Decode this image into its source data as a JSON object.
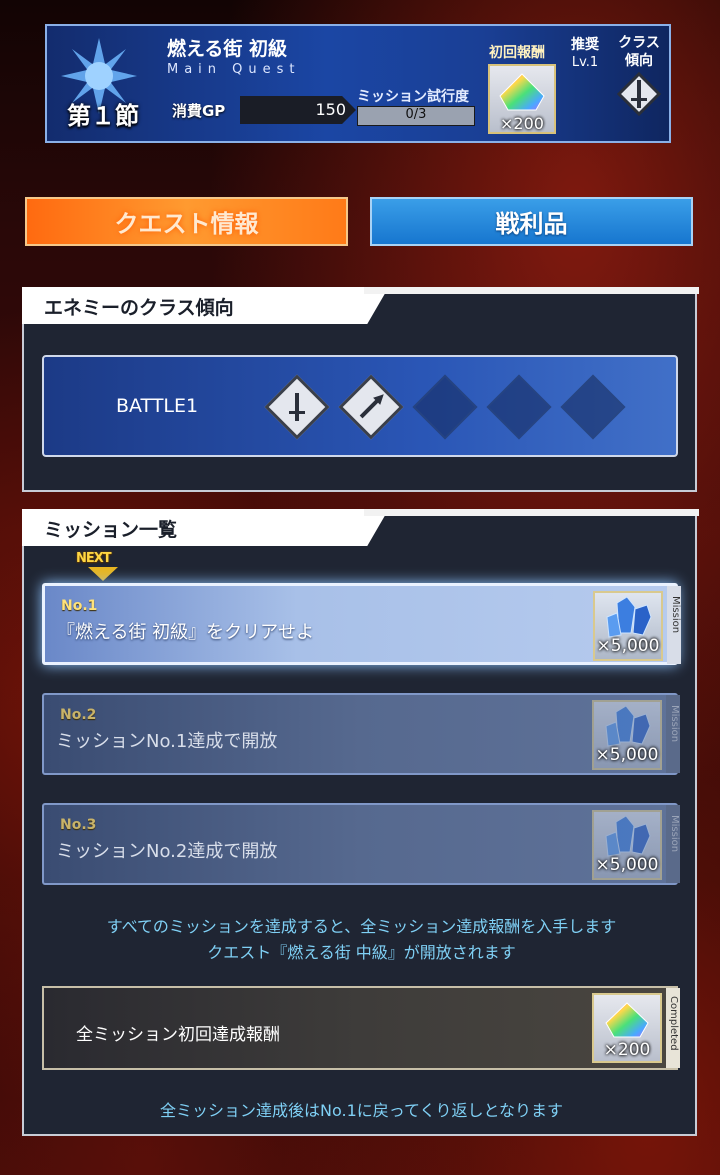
{
  "header": {
    "chapter": "第１節",
    "quest_name": "燃える街 初級",
    "quest_type": "Main Quest",
    "gp_label": "消費GP",
    "gp_value": "150",
    "trial_label": "ミッション試行度",
    "trial_value": "0/3",
    "first_reward_label": "初回報酬",
    "first_reward_count": "×200",
    "recommend_label": "推奨",
    "recommend_level": "Lv.1",
    "class_label": "クラス",
    "class_label2": "傾向",
    "class_icon": "sword-class-icon"
  },
  "tabs": {
    "quest_info": "クエスト情報",
    "spoils": "戦利品"
  },
  "enemy_panel": {
    "title": "エネミーのクラス傾向",
    "battle_label": "BATTLE1",
    "icons": [
      "sword-class-icon",
      "lancer-class-icon"
    ]
  },
  "mission_panel": {
    "title": "ミッション一覧",
    "next_badge": "NEXT",
    "missions": [
      {
        "no": "No.1",
        "text": "『燃える街 初級』をクリアせよ",
        "reward_count": "×5,000",
        "tag": "Mission",
        "state": "active"
      },
      {
        "no": "No.2",
        "text": "ミッションNo.1達成で開放",
        "reward_count": "×5,000",
        "tag": "Mission",
        "state": "locked"
      },
      {
        "no": "No.3",
        "text": "ミッションNo.2達成で開放",
        "reward_count": "×5,000",
        "tag": "Mission",
        "state": "locked"
      }
    ],
    "note_line1": "すべてのミッションを達成すると、全ミッション達成報酬を入手します",
    "note_line2": "クエスト『燃える街 中級』が開放されます",
    "all_reward_label": "全ミッション初回達成報酬",
    "all_reward_count": "×200",
    "all_reward_tag": "Completed",
    "footer_note": "全ミッション達成後はNo.1に戻ってくり返しとなります"
  },
  "colors": {
    "accent_orange": "#ff8a20",
    "accent_blue": "#1f86dd",
    "note_cyan": "#7fd0f5"
  }
}
